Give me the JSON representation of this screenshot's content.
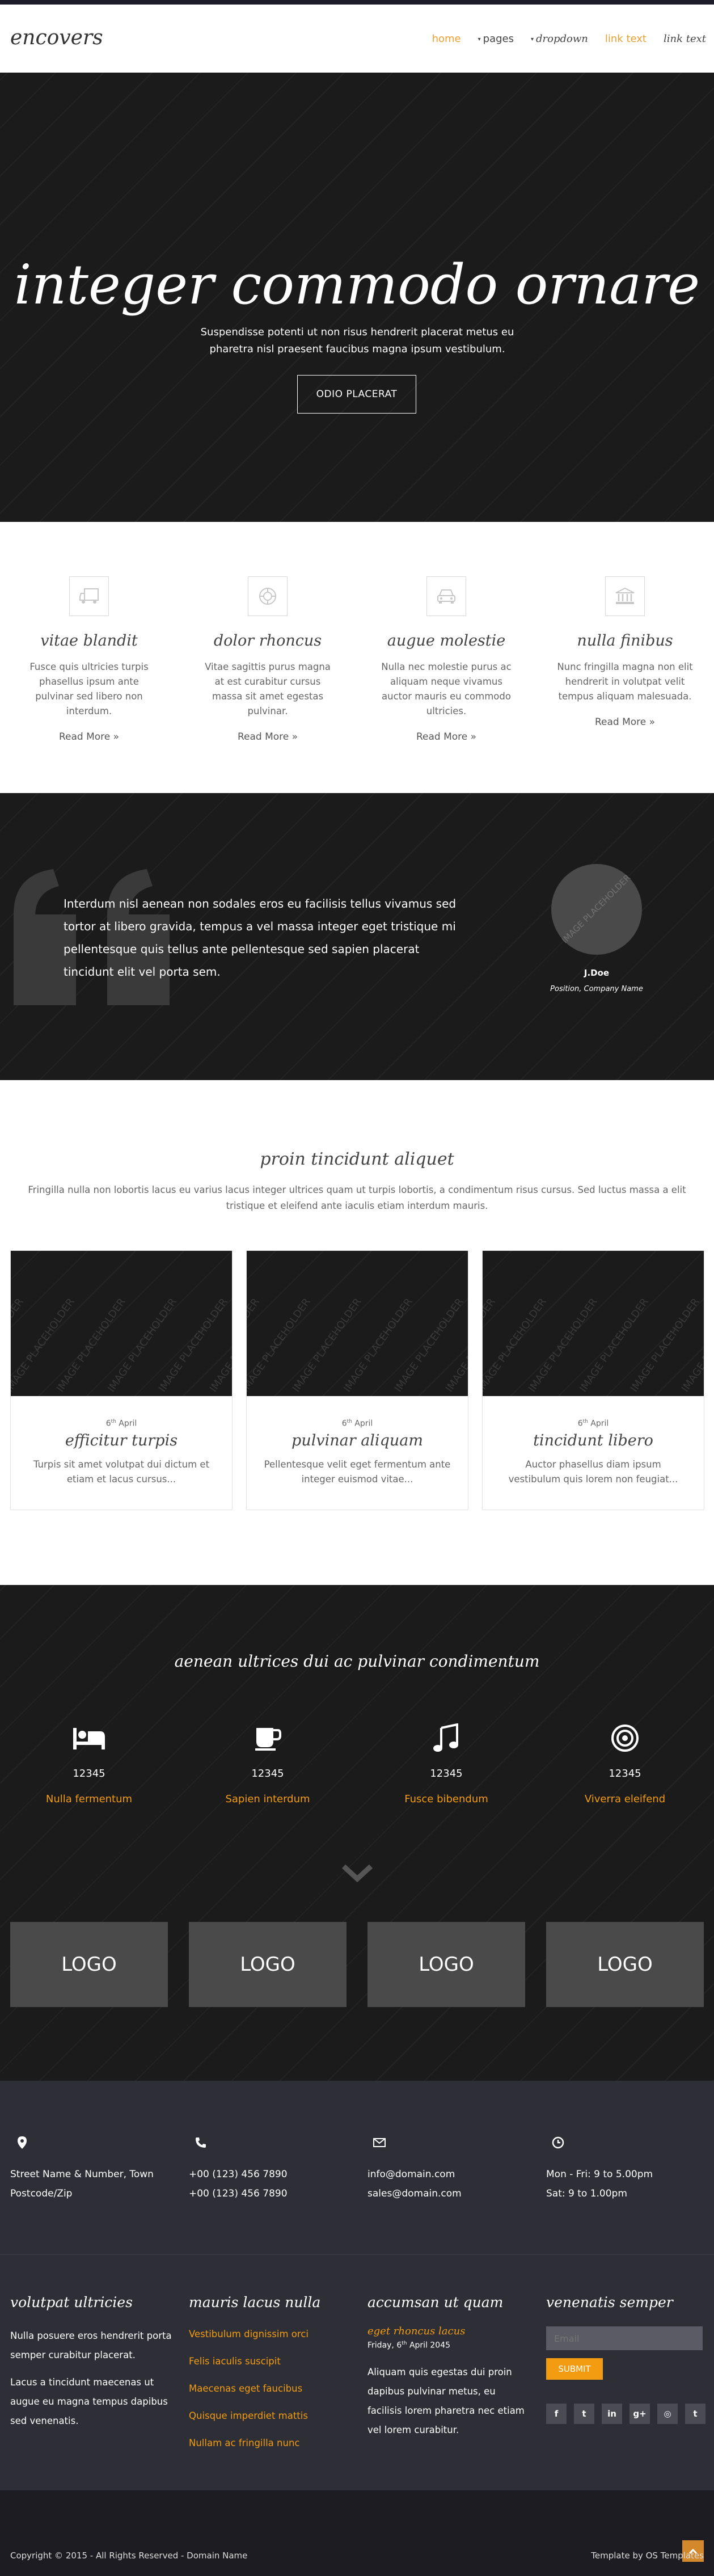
{
  "nav": {
    "brand": "encovers",
    "items": [
      {
        "label": "home"
      },
      {
        "label": "pages"
      },
      {
        "label": "dropdown"
      },
      {
        "label": "link text"
      },
      {
        "label": "link text"
      }
    ]
  },
  "hero": {
    "title": "integer commodo ornare",
    "subtitle": "Suspendisse potenti ut non risus hendrerit placerat metus eu pharetra nisl praesent faucibus magna ipsum vestibulum.",
    "button": "ODIO PLACERAT"
  },
  "features": [
    {
      "icon": "truck-icon",
      "title": "vitae blandit",
      "text": "Fusce quis ultricies turpis phasellus ipsum ante pulvinar sed libero non interdum.",
      "more": "Read More »"
    },
    {
      "icon": "life-ring-icon",
      "title": "dolor rhoncus",
      "text": "Vitae sagittis purus magna at est curabitur cursus massa sit amet egestas pulvinar.",
      "more": "Read More »"
    },
    {
      "icon": "car-icon",
      "title": "augue molestie",
      "text": "Nulla nec molestie purus ac aliquam neque vivamus auctor mauris eu commodo ultricies.",
      "more": "Read More »"
    },
    {
      "icon": "bank-icon",
      "title": "nulla finibus",
      "text": "Nunc fringilla magna non elit hendrerit in volutpat velit tempus aliquam malesuada.",
      "more": "Read More »"
    }
  ],
  "testimonial": {
    "text": "Interdum nisl aenean non sodales eros eu facilisis tellus vivamus sed tortor at libero gravida, tempus a vel massa integer eget tristique mi pellentesque quis tellus ante pellentesque sed sapien placerat tincidunt elit vel porta sem.",
    "name": "J.Doe",
    "position": "Position, Company Name",
    "placeholder": "IMAGE PLACEHOLDER"
  },
  "blog": {
    "title": "proin tincidunt aliquet",
    "subtitle": "Fringilla nulla non lobortis lacus eu varius lacus integer ultrices quam ut turpis lobortis, a condimentum risus cursus. Sed luctus massa a elit tristique et eleifend ante iaculis etiam interdum mauris.",
    "image_placeholder": "IMAGE PLACEHOLDER",
    "posts": [
      {
        "day": "6",
        "suffix": "th",
        "month": "April",
        "title": "efficitur turpis",
        "text": "Turpis sit amet volutpat dui dictum et etiam et lacus cursus..."
      },
      {
        "day": "6",
        "suffix": "th",
        "month": "April",
        "title": "pulvinar aliquam",
        "text": "Pellentesque velit eget fermentum ante integer euismod vitae..."
      },
      {
        "day": "6",
        "suffix": "th",
        "month": "April",
        "title": "tincidunt libero",
        "text": "Auctor phasellus diam ipsum vestibulum quis lorem non feugiat..."
      }
    ]
  },
  "stats": {
    "title": "aenean ultrices dui ac pulvinar condimentum",
    "items": [
      {
        "icon": "bed-icon",
        "number": "12345",
        "label": "Nulla fermentum"
      },
      {
        "icon": "coffee-cup-icon",
        "number": "12345",
        "label": "Sapien interdum"
      },
      {
        "icon": "music-note-icon",
        "number": "12345",
        "label": "Fusce bibendum"
      },
      {
        "icon": "target-icon",
        "number": "12345",
        "label": "Viverra eleifend"
      }
    ],
    "logos": [
      "LOGO",
      "LOGO",
      "LOGO",
      "LOGO"
    ]
  },
  "contact": [
    {
      "icon": "map-marker-icon",
      "lines": [
        "Street Name & Number, Town",
        "Postcode/Zip"
      ]
    },
    {
      "icon": "phone-icon",
      "lines": [
        "+00 (123) 456 7890",
        "+00 (123) 456 7890"
      ]
    },
    {
      "icon": "envelope-icon",
      "lines": [
        "info@domain.com",
        "sales@domain.com"
      ]
    },
    {
      "icon": "clock-icon",
      "lines": [
        "Mon - Fri: 9 to 5.00pm",
        "Sat: 9 to 1.00pm"
      ]
    }
  ],
  "footer": {
    "col1": {
      "title": "volutpat ultricies",
      "p1": "Nulla posuere eros hendrerit porta semper curabitur placerat.",
      "p2": "Lacus a tincidunt maecenas ut augue eu magna tempus dapibus sed venenatis."
    },
    "col2": {
      "title": "mauris lacus nulla",
      "links": [
        "Vestibulum dignissim orci",
        "Felis iaculis suscipit",
        "Maecenas eget faucibus",
        "Quisque imperdiet mattis",
        "Nullam ac fringilla nunc"
      ]
    },
    "col3": {
      "title": "accumsan ut quam",
      "post_title": "eget rhoncus lacus",
      "post_weekday": "Friday,",
      "post_day": "6",
      "post_suffix": "th",
      "post_monthyear": "April 2045",
      "text": "Aliquam quis egestas dui proin dapibus pulvinar metus, eu facilisis lorem pharetra nec etiam vel lorem curabitur."
    },
    "col4": {
      "title": "venenatis semper",
      "email_placeholder": "Email",
      "submit": "SUBMIT",
      "socials": [
        {
          "icon": "facebook-icon",
          "glyph": "f"
        },
        {
          "icon": "twitter-icon",
          "glyph": "t"
        },
        {
          "icon": "linkedin-icon",
          "glyph": "in"
        },
        {
          "icon": "google-plus-icon",
          "glyph": "g+"
        },
        {
          "icon": "instagram-icon",
          "glyph": "◎"
        },
        {
          "icon": "tumblr-icon",
          "glyph": "t"
        }
      ]
    }
  },
  "bottom": {
    "copyright": "Copyright © 2015 - All Rights Reserved - Domain Name",
    "credit": "Template by OS Templates"
  },
  "colors": {
    "accent": "#f39c12",
    "dark": "#1b1b1b",
    "footer": "#2e2f36"
  }
}
